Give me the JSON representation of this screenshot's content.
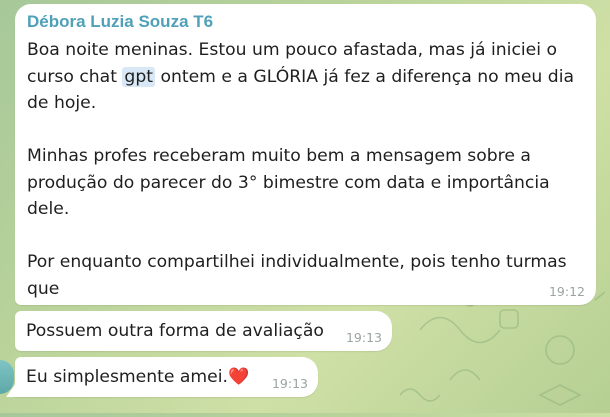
{
  "chat": {
    "messages": [
      {
        "sender": "Débora Luzia Souza T6",
        "paragraphs": [
          {
            "before": "Boa noite meninas. Estou um pouco afastada, mas já iniciei o curso chat ",
            "highlight": "gpt",
            "after": " ontem e a GLÓRIA já fez a diferença no meu dia de hoje."
          },
          {
            "text": "Minhas profes receberam muito bem a mensagem sobre a produção do parecer do 3° bimestre com data e importância dele."
          },
          {
            "text": "Por enquanto compartilhei individualmente, pois tenho turmas que"
          }
        ],
        "time": "19:12"
      },
      {
        "text": "Possuem outra forma de avaliação",
        "time": "19:13"
      },
      {
        "text": "Eu simplesmente amei.",
        "emoji": "❤️",
        "time": "19:13"
      }
    ]
  },
  "colors": {
    "sender_name": "#4fa0b8",
    "bubble": "#ffffff",
    "time": "#9aa4a3",
    "highlight": "#d8e8f6"
  },
  "icons": {
    "emoji_heart": "heart-icon"
  }
}
